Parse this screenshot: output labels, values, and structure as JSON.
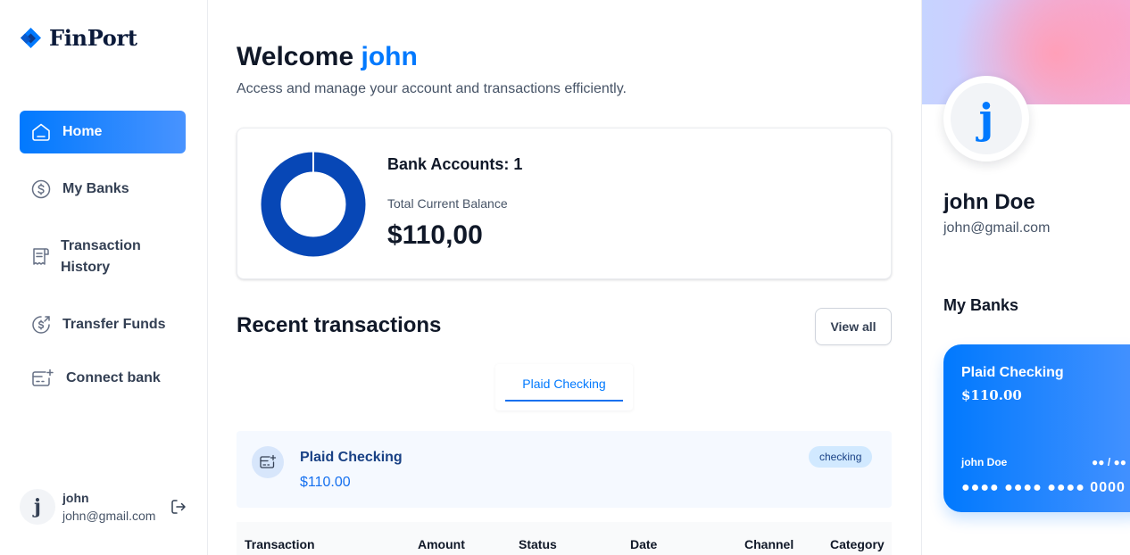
{
  "brand": {
    "name": "FinPort",
    "accent": "#0179fe"
  },
  "sidebar": {
    "items": [
      {
        "label": "Home",
        "icon": "home-icon",
        "active": true
      },
      {
        "label": "My Banks",
        "icon": "dollar-circle-icon"
      },
      {
        "label": "Transaction History",
        "label_line1": "Transaction",
        "label_line2": "History",
        "icon": "receipt-icon"
      },
      {
        "label": "Transfer Funds",
        "icon": "money-send-icon"
      },
      {
        "label": "Connect bank",
        "icon": "connect-bank-icon"
      }
    ],
    "user": {
      "initial": "j",
      "name": "john",
      "email": "john@gmail.com"
    }
  },
  "header": {
    "greeting": "Welcome",
    "user_name": "john",
    "subtext": "Access and manage your account and transactions efficiently."
  },
  "balance": {
    "accounts_label": "Bank Accounts: 1",
    "total_label": "Total Current Balance",
    "total_value": "$110,00",
    "donut_color": "#0747b6"
  },
  "recent": {
    "title": "Recent transactions",
    "view_all": "View all",
    "tabs": [
      {
        "label": "Plaid Checking",
        "active": true
      }
    ],
    "bank": {
      "name": "Plaid Checking",
      "amount": "$110.00",
      "type": "checking"
    },
    "table_columns": [
      "Transaction",
      "Amount",
      "Status",
      "Date",
      "Channel",
      "Category"
    ]
  },
  "profile": {
    "initial": "j",
    "name": "john Doe",
    "email": "john@gmail.com",
    "banks_title": "My Banks",
    "card": {
      "name": "Plaid Checking",
      "balance": "$110.00",
      "holder": "john Doe",
      "expiry": "●● / ●●",
      "number": "●●●● ●●●● ●●●● 0000"
    }
  }
}
